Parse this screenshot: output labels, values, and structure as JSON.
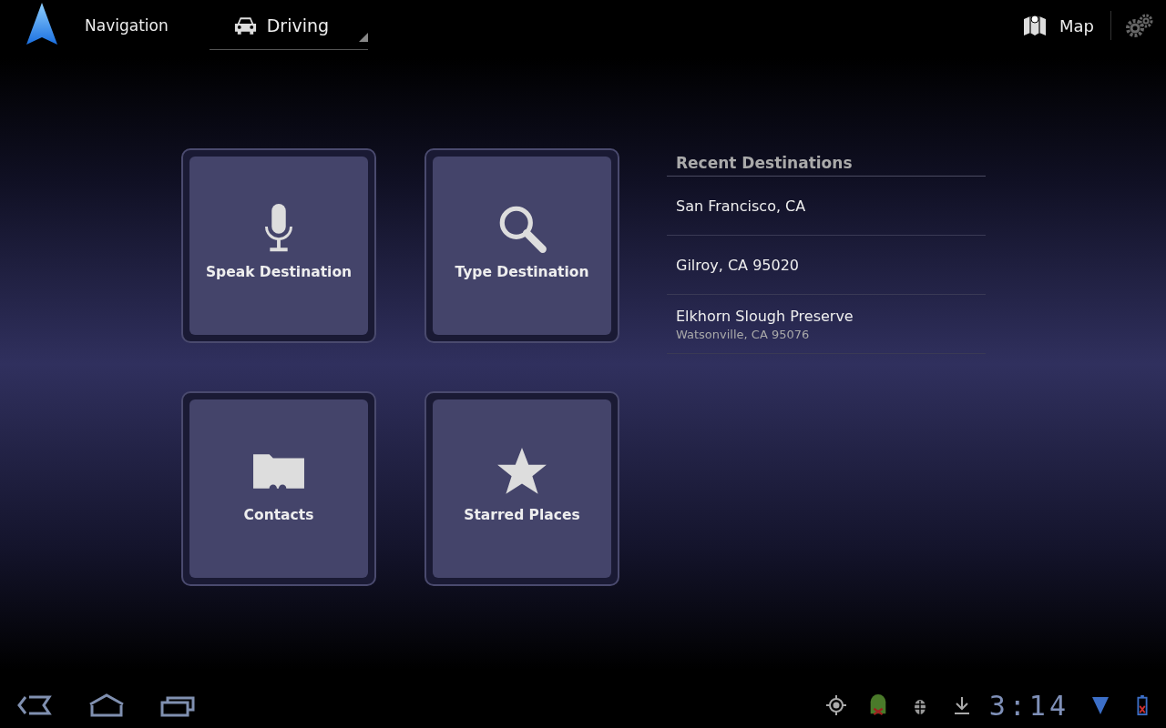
{
  "action_bar": {
    "title": "Navigation",
    "mode": {
      "label": "Driving"
    },
    "map_button": {
      "label": "Map"
    }
  },
  "tiles": [
    {
      "kind": "mic",
      "label": "Speak Destination"
    },
    {
      "kind": "search",
      "label": "Type Destination"
    },
    {
      "kind": "contacts",
      "label": "Contacts"
    },
    {
      "kind": "star",
      "label": "Starred Places"
    }
  ],
  "recent": {
    "title": "Recent Destinations",
    "items": [
      {
        "name": "San Francisco, CA"
      },
      {
        "name": "Gilroy, CA 95020"
      },
      {
        "name": "Elkhorn Slough Preserve",
        "address": "Watsonville, CA 95076"
      }
    ]
  },
  "system_bar": {
    "clock": "3:14"
  }
}
